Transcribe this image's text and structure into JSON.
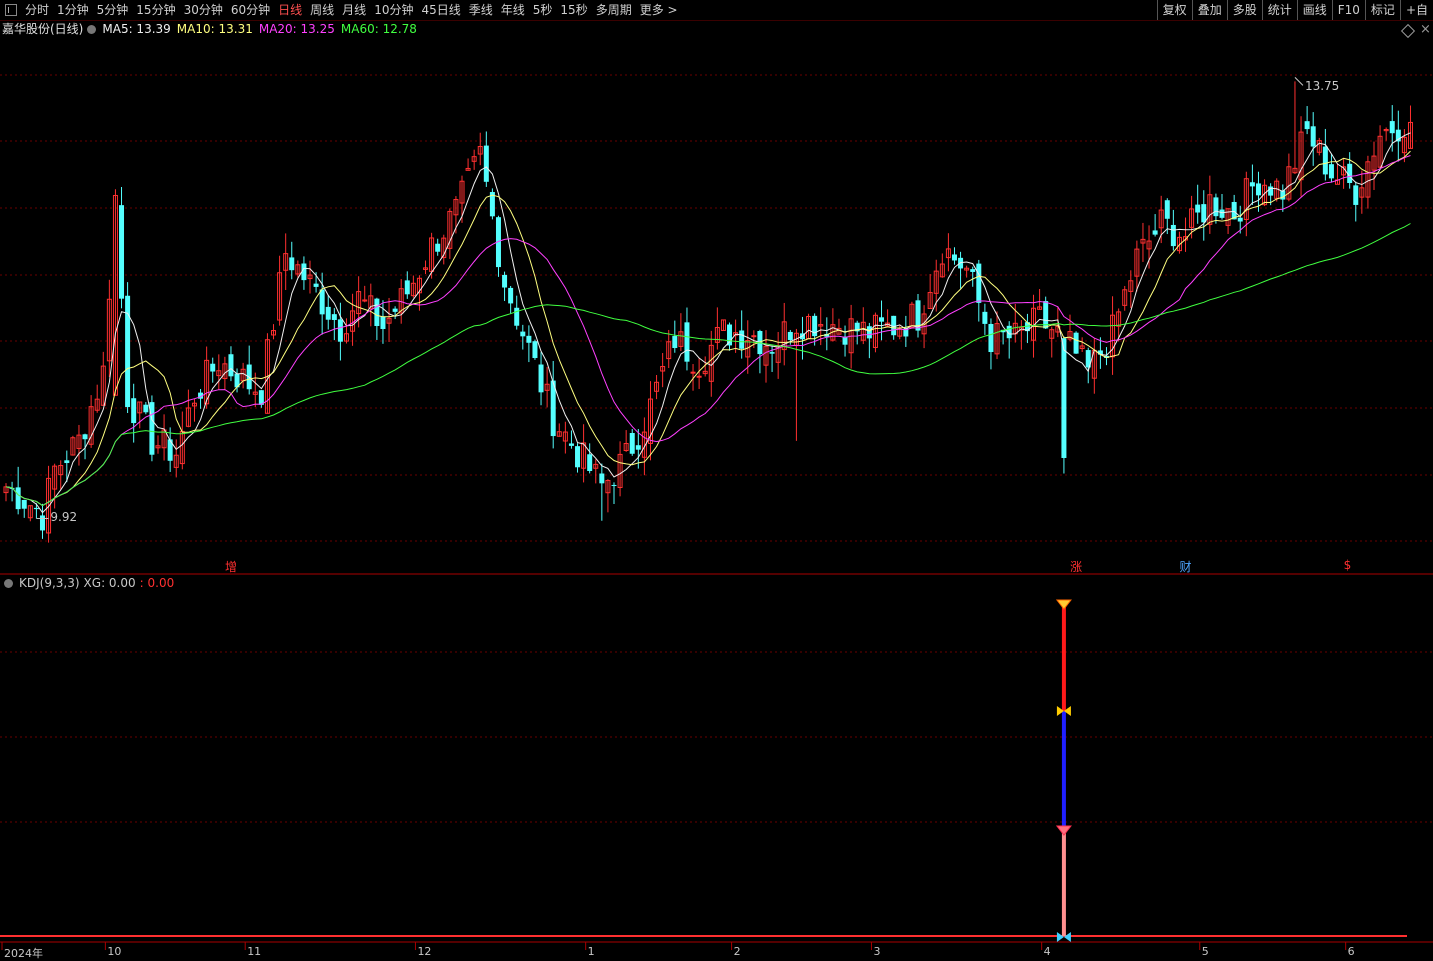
{
  "toolbar": {
    "periods": [
      "分时",
      "1分钟",
      "5分钟",
      "15分钟",
      "30分钟",
      "60分钟",
      "日线",
      "周线",
      "月线",
      "10分钟",
      "45日线",
      "季线",
      "年线",
      "5秒",
      "15秒",
      "多周期",
      "更多 >"
    ],
    "active_index": 6,
    "right_tools": [
      "复权",
      "叠加",
      "多股",
      "统计",
      "画线",
      "F10",
      "标记",
      "+自"
    ]
  },
  "main_panel": {
    "stock_name": "嘉华股份(日线)",
    "ma": [
      {
        "label": "MA5: 13.39",
        "color": "#f0f0f0"
      },
      {
        "label": "MA10: 13.31",
        "color": "#ffff80"
      },
      {
        "label": "MA20: 13.25",
        "color": "#ff40ff"
      },
      {
        "label": "MA60: 12.78",
        "color": "#40ff40"
      }
    ],
    "high_label": "13.75",
    "low_label": "9.92",
    "markers": [
      {
        "text": "增",
        "color": "#ff3030",
        "index": 37
      },
      {
        "text": "涨",
        "color": "#ff3030",
        "index": 176
      },
      {
        "text": "财",
        "color": "#4da6ff",
        "index": 194
      },
      {
        "text": "$",
        "color": "#ff3030",
        "index": 221
      }
    ]
  },
  "sub_panel": {
    "title": "KDJ(9,3,3)",
    "xg": "XG: 0.00",
    "xg_value": ": 0.00",
    "xg_value_color": "#ff3030"
  },
  "x_axis": [
    {
      "label": "2024年",
      "index": 0
    },
    {
      "label": "10",
      "index": 17
    },
    {
      "label": "11",
      "index": 40
    },
    {
      "label": "12",
      "index": 68
    },
    {
      "label": "1",
      "index": 96
    },
    {
      "label": "2",
      "index": 120
    },
    {
      "label": "3",
      "index": 143
    },
    {
      "label": "4",
      "index": 171
    },
    {
      "label": "5",
      "index": 197
    },
    {
      "label": "6",
      "index": 221
    }
  ],
  "colors": {
    "up": "#ff3030",
    "down": "#54ffff",
    "grid": "#6a0000",
    "ma5": "#f0f0f0",
    "ma10": "#ffff80",
    "ma20": "#ff40ff",
    "ma60": "#40ff40"
  },
  "chart_data": {
    "type": "candlestick",
    "price_range": [
      9.92,
      13.75
    ],
    "anchors": [
      [
        0,
        10.2
      ],
      [
        4,
        10.05
      ],
      [
        6,
        9.95
      ],
      [
        8,
        10.35
      ],
      [
        12,
        10.6
      ],
      [
        16,
        11.2
      ],
      [
        18,
        12.7
      ],
      [
        20,
        11.0
      ],
      [
        24,
        10.6
      ],
      [
        28,
        10.5
      ],
      [
        31,
        11.0
      ],
      [
        35,
        11.3
      ],
      [
        40,
        11.1
      ],
      [
        42,
        11.05
      ],
      [
        46,
        12.25
      ],
      [
        51,
        11.9
      ],
      [
        55,
        11.6
      ],
      [
        58,
        11.85
      ],
      [
        62,
        11.6
      ],
      [
        66,
        11.9
      ],
      [
        70,
        12.3
      ],
      [
        74,
        12.6
      ],
      [
        78,
        13.1
      ],
      [
        82,
        12.0
      ],
      [
        86,
        11.4
      ],
      [
        90,
        10.8
      ],
      [
        94,
        10.5
      ],
      [
        98,
        10.2
      ],
      [
        102,
        10.45
      ],
      [
        106,
        10.9
      ],
      [
        110,
        11.5
      ],
      [
        114,
        11.3
      ],
      [
        118,
        11.55
      ],
      [
        122,
        11.55
      ],
      [
        126,
        11.45
      ],
      [
        130,
        11.65
      ],
      [
        134,
        11.65
      ],
      [
        138,
        11.6
      ],
      [
        142,
        11.55
      ],
      [
        146,
        11.6
      ],
      [
        150,
        11.7
      ],
      [
        154,
        12.3
      ],
      [
        158,
        12.1
      ],
      [
        162,
        11.5
      ],
      [
        166,
        11.5
      ],
      [
        170,
        11.65
      ],
      [
        174,
        11.5
      ],
      [
        178,
        11.2
      ],
      [
        182,
        11.55
      ],
      [
        186,
        12.2
      ],
      [
        190,
        12.5
      ],
      [
        194,
        12.4
      ],
      [
        198,
        12.7
      ],
      [
        202,
        12.6
      ],
      [
        206,
        12.9
      ],
      [
        210,
        12.8
      ],
      [
        214,
        13.3
      ],
      [
        218,
        12.95
      ],
      [
        222,
        12.8
      ],
      [
        226,
        13.3
      ],
      [
        230,
        13.4
      ],
      [
        231,
        13.39
      ]
    ]
  }
}
